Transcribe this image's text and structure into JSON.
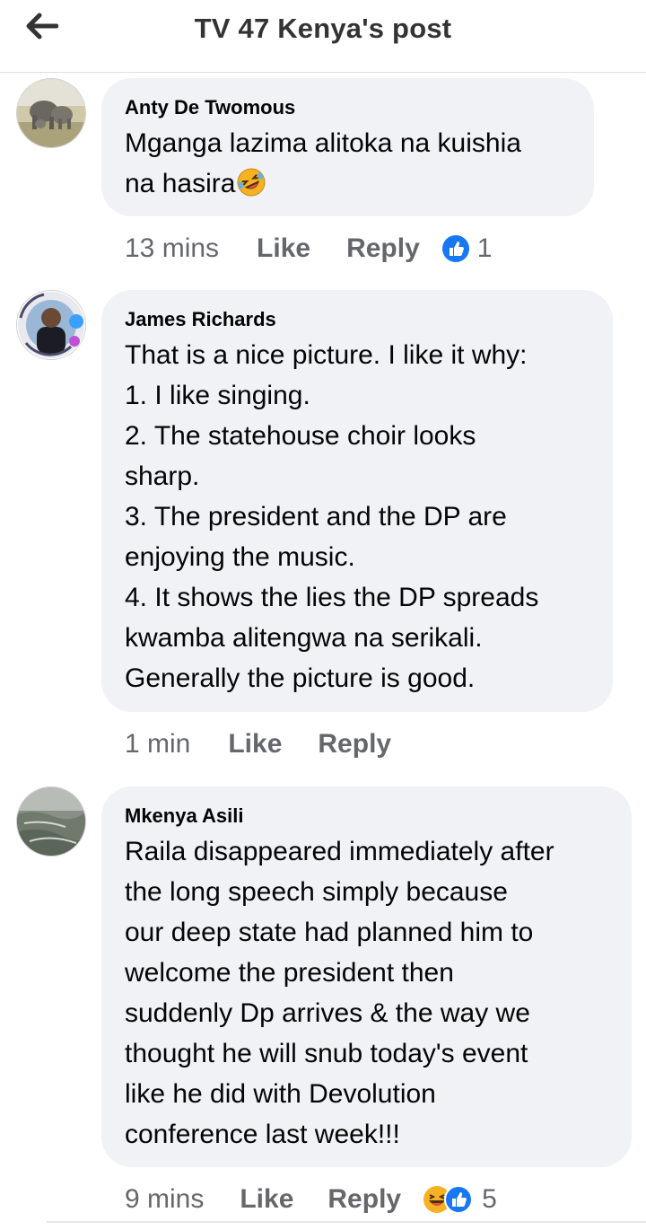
{
  "header": {
    "title": "TV 47 Kenya's post",
    "back_icon": "arrow-left-icon"
  },
  "comments": [
    {
      "author": "Anty De Twomous",
      "text": "Mganga lazima alitoka na kuishia\nna hasira",
      "time": "13 mins",
      "like_label": "Like",
      "reply_label": "Reply",
      "reaction_count": "1",
      "reactions": [
        "like-icon"
      ]
    },
    {
      "author": "James Richards",
      "text": "That is a nice picture. I like it why:\n1. I like singing.\n2. The statehouse choir looks\nsharp.\n3. The president and the DP are\nenjoying the music.\n4. It shows the lies the DP spreads\nkwamba alitengwa na serikali.\nGenerally the picture is good.",
      "time": "1 min",
      "like_label": "Like",
      "reply_label": "Reply"
    },
    {
      "author": "Mkenya Asili",
      "text": "Raila disappeared immediately after\nthe long speech simply because\nour deep state had planned him to\nwelcome the president then\nsuddenly Dp arrives & the way we\nthought he will snub today's event\nlike he did with Devolution\nconference last week!!!",
      "time": "9 mins",
      "like_label": "Like",
      "reply_label": "Reply",
      "reaction_count": "5",
      "reactions": [
        "laugh-icon",
        "like-icon"
      ]
    }
  ],
  "colors": {
    "bubble": "#f0f2f5",
    "meta_text": "#65676b",
    "like_blue": "#1877f2",
    "laugh_yellow": "#f7b125"
  }
}
